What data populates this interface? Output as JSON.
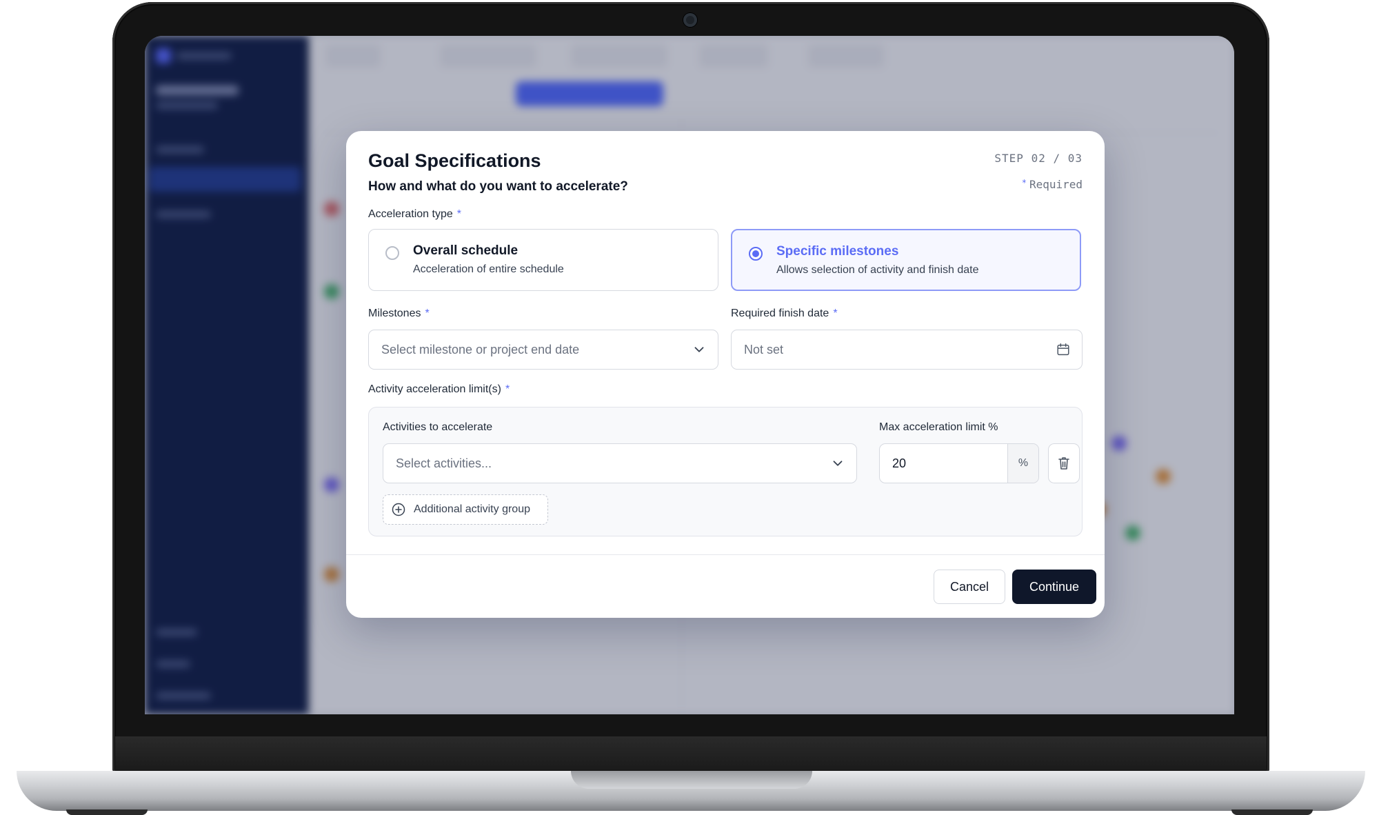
{
  "modal": {
    "title": "Goal Specifications",
    "subtitle": "How and what do you want to accelerate?",
    "step": "STEP 02 / 03",
    "required_note": "Required",
    "acceleration_type": {
      "label": "Acceleration type",
      "options": [
        {
          "title": "Overall schedule",
          "description": "Acceleration of entire schedule",
          "selected": false
        },
        {
          "title": "Specific milestones",
          "description": "Allows selection of activity and finish date",
          "selected": true
        }
      ]
    },
    "milestones": {
      "label": "Milestones",
      "placeholder": "Select milestone or project end date"
    },
    "finish_date": {
      "label": "Required finish date",
      "value": "Not set"
    },
    "activity_limits": {
      "label": "Activity acceleration limit(s)",
      "activities_label": "Activities to accelerate",
      "activities_placeholder": "Select activities...",
      "max_limit_label": "Max acceleration limit %",
      "max_limit_value": "20",
      "unit": "%",
      "add_group_label": "Additional activity group"
    },
    "buttons": {
      "cancel": "Cancel",
      "continue": "Continue"
    }
  },
  "colors": {
    "accent": "#5b6cf5",
    "primary_button": "#0f172a",
    "sidebar": "#0c1a44"
  }
}
